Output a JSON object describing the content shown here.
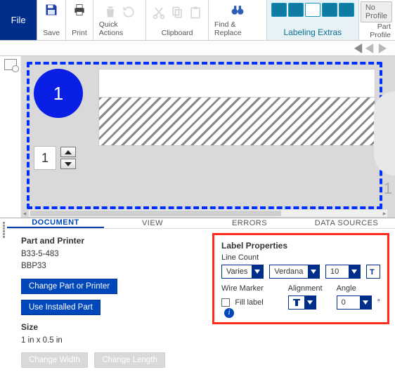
{
  "ribbon": {
    "file": "File",
    "save": "Save",
    "print": "Print",
    "quick": "Quick Actions",
    "clipboard": "Clipboard",
    "find": "Find & Replace",
    "extras": "Labeling Extras",
    "no_profile": "No Profile",
    "part_profile": "Part Profile"
  },
  "canvas": {
    "die_number": "1",
    "stepper_value": "1",
    "ghost_number": "1"
  },
  "tabs": {
    "document": "DOCUMENT",
    "view": "VIEW",
    "errors": "ERRORS",
    "data": "DATA SOURCES"
  },
  "doc": {
    "part_h": "Part and Printer",
    "part_no": "B33-5-483",
    "printer": "BBP33",
    "change_btn": "Change Part or Printer",
    "installed_btn": "Use Installed Part",
    "size_h": "Size",
    "size_val": "1 in x 0.5 in",
    "cw_btn": "Change Width",
    "cl_btn": "Change Length"
  },
  "props": {
    "h": "Label Properties",
    "linecount_lbl": "Line Count",
    "linecount_val": "Varies",
    "font_val": "Verdana",
    "fontsize_val": "10",
    "wire_lbl": "Wire Marker",
    "fill_lbl": "Fill label",
    "align_lbl": "Alignment",
    "angle_lbl": "Angle",
    "angle_val": "0"
  }
}
